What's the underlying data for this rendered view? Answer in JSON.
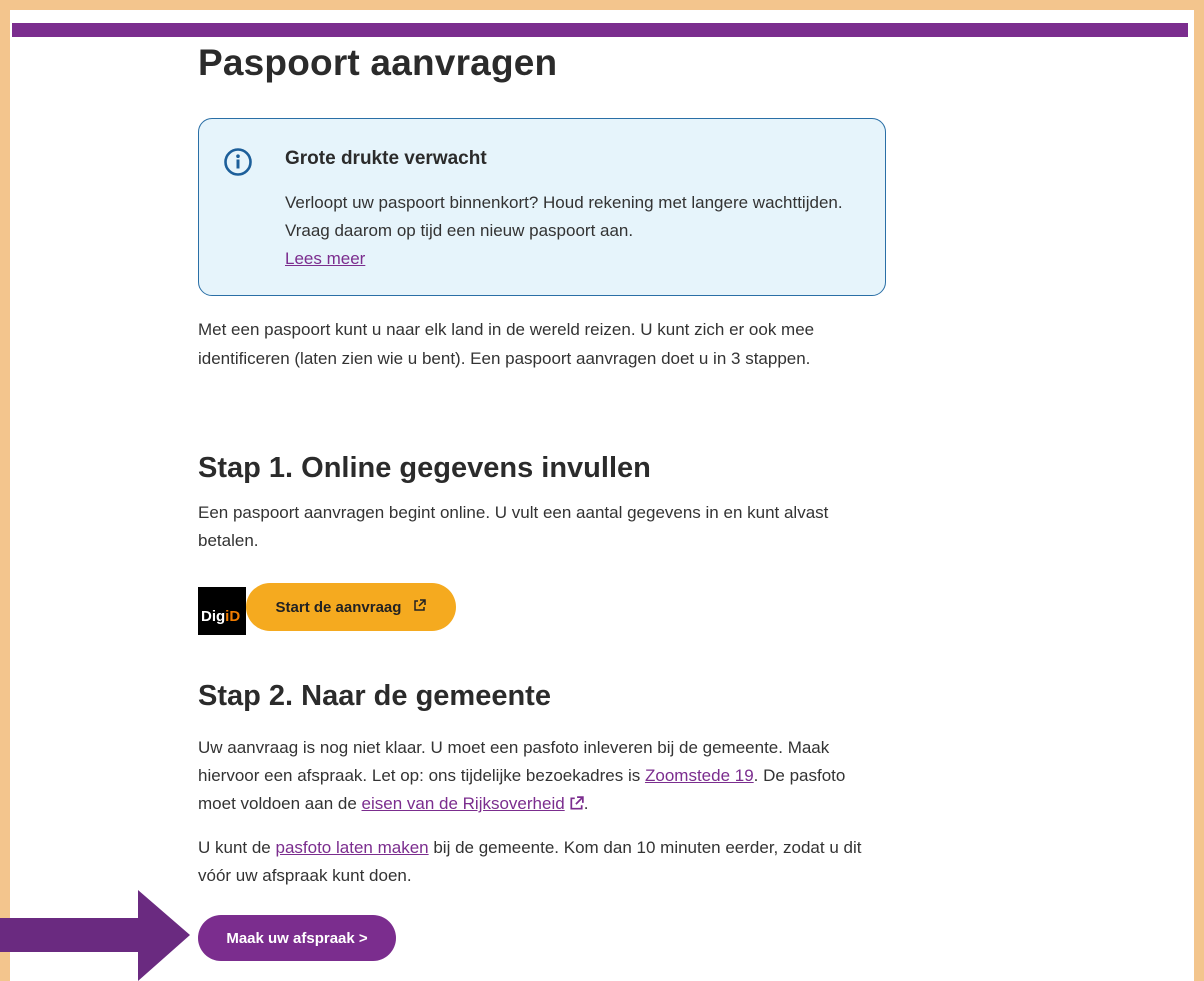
{
  "page": {
    "title": "Paspoort aanvragen"
  },
  "notice": {
    "icon": "info-icon",
    "title": "Grote drukte verwacht",
    "text": "Verloopt uw paspoort binnenkort? Houd rekening met langere wachttijden. Vraag daarom op tijd een nieuw paspoort aan.",
    "link": "Lees meer",
    "colors": {
      "background": "#e6f4fb",
      "border": "#2a6fa6"
    }
  },
  "intro": "Met een paspoort kunt u naar elk land in de wereld reizen. U kunt zich er ook mee identificeren (laten zien wie u bent). Een paspoort aanvragen doet u in 3 stappen.",
  "step1": {
    "heading": "Stap 1. Online gegevens invullen",
    "text": "Een paspoort aanvragen begint online. U vult een aantal gegevens in en kunt alvast betalen.",
    "digid_part1": "Dig",
    "digid_part2": "iD",
    "button": "Start de aanvraag"
  },
  "step2": {
    "heading": "Stap 2. Naar de gemeente",
    "text_a": "Uw aanvraag is nog niet klaar. U moet een pasfoto inleveren bij de gemeente. Maak hiervoor een afspraak. Let op: ons tijdelijke bezoekadres is ",
    "link_address": "Zoomstede 19",
    "text_b": ". De pasfoto moet voldoen aan de ",
    "link_requirements": "eisen van de Rijksoverheid",
    "text_c": ".",
    "text_d": "U kunt de ",
    "link_photo": "pasfoto laten maken",
    "text_e": " bij de gemeente. Kom dan 10 minuten eerder, zodat u dit vóór uw afspraak kunt doen.",
    "button": "Maak uw afspraak >"
  },
  "colors": {
    "brand_purple": "#7b2d8e",
    "button_orange": "#f5aa1f",
    "frame_border": "#f3c58d"
  }
}
